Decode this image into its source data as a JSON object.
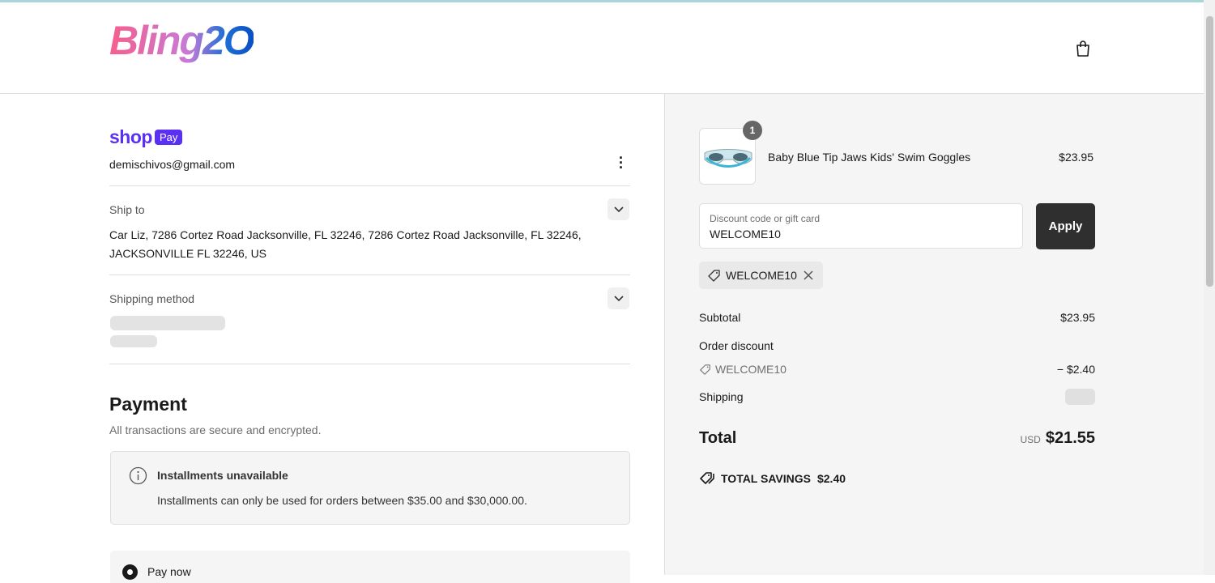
{
  "header": {
    "logo": "Bling2O",
    "cart_icon": "shopping-bag-icon"
  },
  "contact": {
    "shop_label": "shop",
    "pay_label": "Pay",
    "email": "demischivos@gmail.com"
  },
  "ship_to": {
    "label": "Ship to",
    "address": "Car Liz, 7286 Cortez Road Jacksonville, FL 32246, 7286 Cortez Road Jacksonville, FL 32246, JACKSONVILLE FL 32246, US"
  },
  "shipping_method": {
    "label": "Shipping method"
  },
  "payment": {
    "title": "Payment",
    "subtitle": "All transactions are secure and encrypted.",
    "notice_title": "Installments unavailable",
    "notice_text": "Installments can only be used for orders between $35.00 and $30,000.00.",
    "option": "Pay now"
  },
  "summary": {
    "item": {
      "name": "Baby Blue Tip Jaws Kids' Swim Goggles",
      "price": "$23.95",
      "quantity": "1"
    },
    "discount_placeholder": "Discount code or gift card",
    "discount_value": "WELCOME10",
    "apply": "Apply",
    "applied_code": "WELCOME10",
    "subtotal_label": "Subtotal",
    "subtotal": "$23.95",
    "order_discount_label": "Order discount",
    "discount_code": "WELCOME10",
    "discount_amount": "− $2.40",
    "shipping_label": "Shipping",
    "total_label": "Total",
    "currency": "USD",
    "total": "$21.55",
    "savings_label": "TOTAL SAVINGS",
    "savings": "$2.40"
  }
}
